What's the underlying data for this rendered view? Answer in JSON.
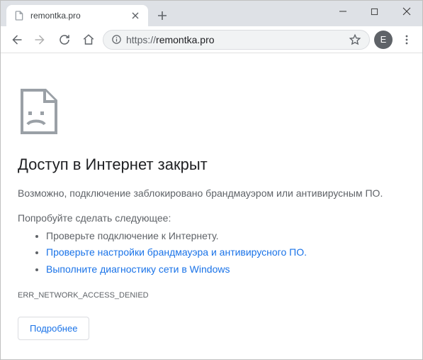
{
  "window": {
    "tab_title": "remontka.pro",
    "avatar_initial": "E"
  },
  "omnibox": {
    "scheme": "https://",
    "host": "remontka.pro",
    "path": ""
  },
  "error": {
    "heading": "Доступ в Интернет закрыт",
    "message": "Возможно, подключение заблокировано брандмауэром или антивирусным ПО.",
    "try_label": "Попробуйте сделать следующее:",
    "suggestions": [
      {
        "text": "Проверьте подключение к Интернету.",
        "link": false
      },
      {
        "text": "Проверьте настройки брандмауэра и антивирусного ПО.",
        "link": true
      },
      {
        "text": "Выполните диагностику сети в Windows",
        "link": true
      }
    ],
    "code": "ERR_NETWORK_ACCESS_DENIED",
    "details_button": "Подробнее"
  }
}
